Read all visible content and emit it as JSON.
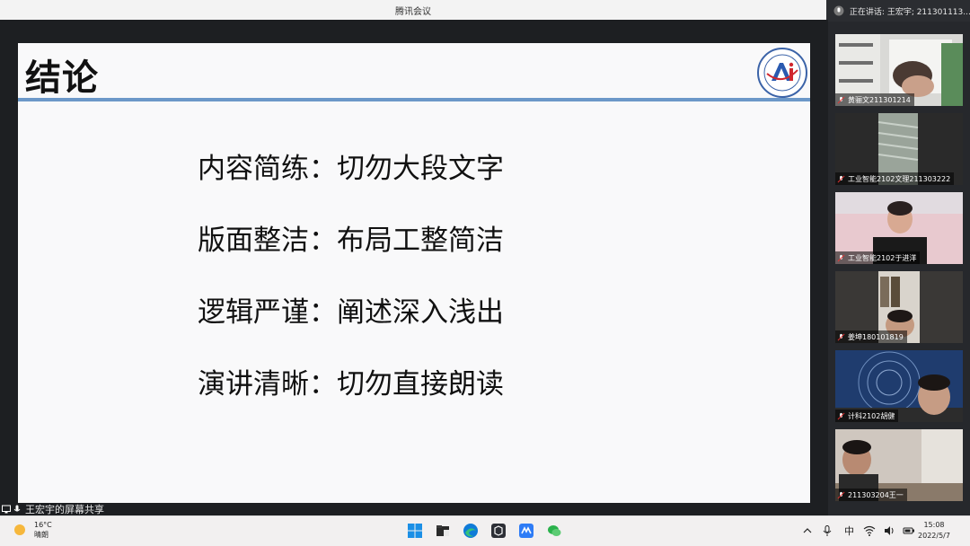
{
  "window": {
    "title": "腾讯会议",
    "speaking_text": "正在讲话: 王宏宇; 211301113..."
  },
  "slide": {
    "title": "结论",
    "bullets": [
      "内容简练：切勿大段文字",
      "版面整洁：布局工整简洁",
      "逻辑严谨：阐述深入浅出",
      "演讲清晰：切勿直接朗读"
    ],
    "accent_color": "#6c98c8"
  },
  "share": {
    "status_text": "王宏宇的屏幕共享"
  },
  "participants": [
    {
      "name": "黄骊文211301214"
    },
    {
      "name": "工业智能2102文理211303222"
    },
    {
      "name": "工业智能2102于进洋"
    },
    {
      "name": "姜坤180101819"
    },
    {
      "name": "计科2102胡健"
    },
    {
      "name": "211303204王一"
    }
  ],
  "taskbar": {
    "weather_temp": "16°C",
    "weather_desc": "晴朗",
    "ime": "中",
    "time": "15:08",
    "date": "2022/5/7",
    "apps": [
      "windows-start-icon",
      "file-explorer-icon",
      "edge-browser-icon",
      "app-icon",
      "tencent-meeting-icon",
      "wechat-icon"
    ]
  }
}
